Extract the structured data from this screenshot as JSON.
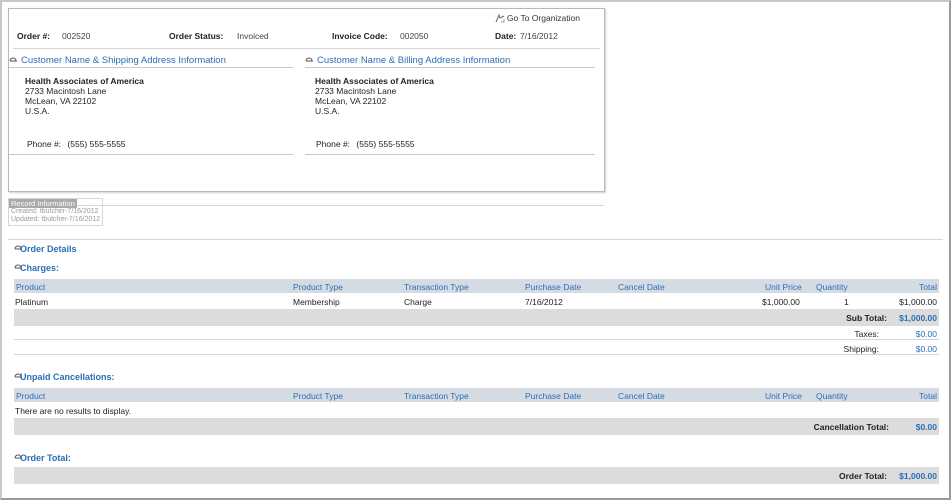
{
  "order_header": {
    "goto_label": "Go To Organization",
    "order_label": "Order #:",
    "order_value": "002520",
    "status_label": "Order Status:",
    "status_value": "Invoiced",
    "invoice_label": "Invoice Code:",
    "invoice_value": "002050",
    "date_label": "Date:",
    "date_value": "7/16/2012"
  },
  "shipping": {
    "title": "Customer Name & Shipping Address Information",
    "name": "Health Associates of America",
    "street": "2733 Macintosh Lane",
    "city": "McLean, VA 22102",
    "country": "U.S.A.",
    "phone_label": "Phone #:",
    "phone_value": "(555) 555-5555"
  },
  "billing": {
    "title": "Customer Name & Billing Address Information",
    "name": "Health Associates of America",
    "street": "2733 Macintosh Lane",
    "city": "McLean, VA 22102",
    "country": "U.S.A.",
    "phone_label": "Phone #:",
    "phone_value": "(555) 555-5555"
  },
  "record_info": {
    "title": "Record Information",
    "created_label": "Created:",
    "created_value": "tbutcher-7/16/2012",
    "updated_label": "Updated:",
    "updated_value": "tbutcher-7/16/2012"
  },
  "order_details": {
    "title": "Order Details"
  },
  "columns": {
    "product": "Product",
    "product_type": "Product Type",
    "transaction_type": "Transaction Type",
    "purchase_date": "Purchase Date",
    "cancel_date": "Cancel Date",
    "unit_price": "Unit Price",
    "quantity": "Quantity",
    "total": "Total"
  },
  "charges": {
    "title": "Charges:",
    "rows": [
      {
        "product": "Platinum",
        "product_type": "Membership",
        "transaction_type": "Charge",
        "purchase_date": "7/16/2012",
        "cancel_date": "",
        "unit_price": "$1,000.00",
        "quantity": "1",
        "total": "$1,000.00"
      }
    ],
    "subtotal_label": "Sub Total:",
    "subtotal_value": "$1,000.00",
    "taxes_label": "Taxes:",
    "taxes_value": "$0.00",
    "shipping_label": "Shipping:",
    "shipping_value": "$0.00"
  },
  "unpaid": {
    "title": "Unpaid Cancellations:",
    "empty_text": "There are no results to display.",
    "total_label": "Cancellation Total:",
    "total_value": "$0.00"
  },
  "order_total": {
    "title": "Order Total:",
    "label": "Order Total:",
    "value": "$1,000.00"
  },
  "colors": {
    "link_blue": "#2a6fb5",
    "grid_header_bg": "#d5dbe3",
    "summary_bar_bg": "#dcdcdc"
  },
  "icons": {
    "goto": "link-arrow-icon",
    "section": "collapse-toggle-icon"
  }
}
